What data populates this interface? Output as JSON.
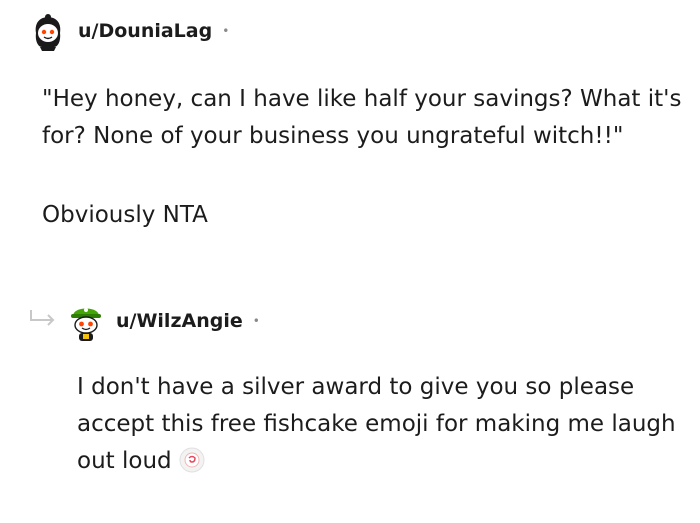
{
  "comments": [
    {
      "username": "u/DouniaLag",
      "separator": "•",
      "paragraphs": [
        "\"Hey honey, can I have like half your savings? What it's for? None of your business you ungrateful witch!!\"",
        "Obviously NTA"
      ]
    },
    {
      "username": "u/WilzAngie",
      "separator": "•",
      "text": "I don't have a silver award to give you so please accept this free fishcake emoji for making me laugh out loud",
      "emoji": "fishcake-emoji"
    }
  ]
}
